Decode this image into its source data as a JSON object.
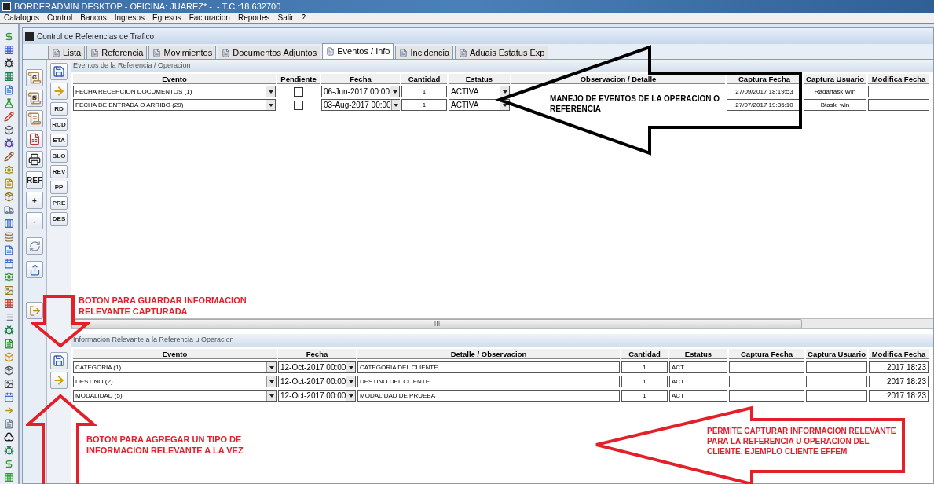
{
  "window": {
    "title": "BORDERADMIN DESKTOP - OFICINA: JUAREZ* -  - T.C.:18.632700"
  },
  "menu": [
    "Catalogos",
    "Control",
    "Bancos",
    "Ingresos",
    "Egresos",
    "Facturacion",
    "Reportes",
    "Salir",
    "?"
  ],
  "child_window": {
    "title": "Control de Referencias de Trafico"
  },
  "tabs": [
    {
      "label": "Lista",
      "selected": false
    },
    {
      "label": "Referencia",
      "selected": false
    },
    {
      "label": "Movimientos",
      "selected": false
    },
    {
      "label": "Documentos Adjuntos",
      "selected": false
    },
    {
      "label": "Eventos / Info",
      "selected": true
    },
    {
      "label": "Incidencia",
      "selected": false
    },
    {
      "label": "Aduais Estatus Exp",
      "selected": false
    }
  ],
  "tool_column_1": [
    {
      "kind": "scroll",
      "label": "C"
    },
    {
      "kind": "scroll",
      "label": "B"
    },
    {
      "kind": "scroll"
    },
    {
      "kind": "report"
    },
    {
      "kind": "printer"
    },
    {
      "kind": "text",
      "label": "REF"
    },
    {
      "kind": "text",
      "label": "+"
    },
    {
      "kind": "text",
      "label": "-"
    },
    {
      "kind": "refresh"
    },
    {
      "kind": "export"
    },
    {
      "kind": "exit"
    }
  ],
  "tool_column_2": [
    {
      "kind": "save"
    },
    {
      "kind": "add"
    },
    {
      "kind": "text",
      "label": "RD"
    },
    {
      "kind": "text",
      "label": "RCD"
    },
    {
      "kind": "text",
      "label": "ETA"
    },
    {
      "kind": "text",
      "label": "BLO"
    },
    {
      "kind": "text",
      "label": "REV"
    },
    {
      "kind": "text",
      "label": "PP"
    },
    {
      "kind": "text",
      "label": "PRE"
    },
    {
      "kind": "text",
      "label": "DES"
    }
  ],
  "tool_column_3": [
    {
      "kind": "save"
    },
    {
      "kind": "add"
    }
  ],
  "events_panel": {
    "title": "Eventos de la Referencia / Operacion",
    "columns": [
      "Evento",
      "Pendiente",
      "Fecha",
      "Cantidad",
      "Estatus",
      "Observacion / Detalle",
      "Captura Fecha",
      "Captura Usuario",
      "Modifica Fecha"
    ],
    "rows": [
      {
        "evento": "FECHA RECEPCION DOCUMENTOS (1)",
        "pendiente": false,
        "fecha": "06-Jun-2017 00:00",
        "cantidad": "1",
        "estatus": "ACTIVA",
        "captura_fecha": "27/09/2017 18:19:53",
        "captura_usuario": "Radartask Win"
      },
      {
        "evento": "FECHA DE ENTRADA O ARRIBO (29)",
        "pendiente": false,
        "fecha": "03-Aug-2017 00:00",
        "cantidad": "1",
        "estatus": "ACTIVA",
        "captura_fecha": "27/07/2017 19:35:10",
        "captura_usuario": "Btask_win"
      }
    ]
  },
  "info_panel": {
    "title": "Informacion Relevante a la Referencia u Operacion",
    "columns": [
      "Evento",
      "Fecha",
      "Detalle / Observacion",
      "Cantidad",
      "Estatus",
      "Captura Fecha",
      "Captura Usuario",
      "Modifica Fecha"
    ],
    "rows": [
      {
        "evento": "CATEGORIA (1)",
        "fecha": "12-Oct-2017 00:00",
        "detalle": "CATEGORIA DEL CLIENTE",
        "cantidad": "1",
        "estatus": "ACT",
        "modifica_fecha": "2017 18:23"
      },
      {
        "evento": "DESTINO (2)",
        "fecha": "12-Oct-2017 00:00",
        "detalle": "DESTINO DEL CLIENTE",
        "cantidad": "1",
        "estatus": "ACT",
        "modifica_fecha": "2017 18:23"
      },
      {
        "evento": "MODALIDAD (5)",
        "fecha": "12-Oct-2017 00:00",
        "detalle": "MODALIDAD DE PRUEBA",
        "cantidad": "1",
        "estatus": "ACT",
        "modifica_fecha": "2017 18:23"
      }
    ]
  },
  "annotations": [
    {
      "kind": "left",
      "text": "MANEJO DE EVENTOS DE LA OPERACION O REFERENCIA",
      "color": "#000000"
    },
    {
      "kind": "down",
      "text": "BOTON PARA GUARDAR INFORMACION RELEVANTE CAPTURADA",
      "color": "#e3202a"
    },
    {
      "kind": "up",
      "text": "BOTON PARA AGREGAR UN TIPO DE INFORMACION RELEVANTE A LA VEZ",
      "color": "#e3202a"
    },
    {
      "kind": "left_boxed",
      "text": "PERMITE CAPTURAR INFORMACION RELEVANTE PARA LA REFERENCIA U OPERACION DEL CLIENTE. EJEMPLO CLIENTE EFFEM",
      "color": "#e3202a"
    }
  ]
}
